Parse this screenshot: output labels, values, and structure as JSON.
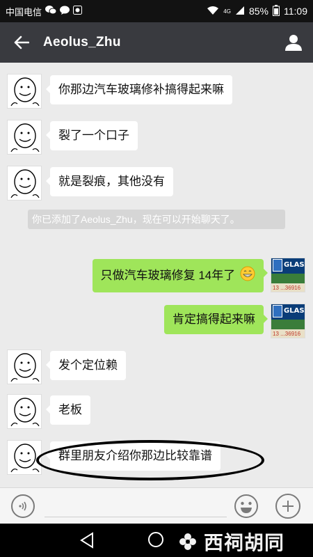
{
  "status_bar": {
    "carrier": "中国电信",
    "signal_label": "4G",
    "battery": "85%",
    "time": "11:09"
  },
  "header": {
    "title": "Aeolus_Zhu"
  },
  "messages": [
    {
      "side": "in",
      "text": "你那边汽车玻璃修补搞得起来嘛"
    },
    {
      "side": "in",
      "text": "裂了一个口子"
    },
    {
      "side": "in",
      "text": "就是裂痕，其他没有"
    },
    {
      "side": "system",
      "text": "你已添加了Aeolus_Zhu，现在可以开始聊天了。"
    },
    {
      "side": "out",
      "text": "只做汽车玻璃修复 14年了"
    },
    {
      "side": "out",
      "text": "肯定搞得起来嘛"
    },
    {
      "side": "in",
      "text": "发个定位赖"
    },
    {
      "side": "in",
      "text": "老板"
    },
    {
      "side": "in",
      "text": "群里朋友介绍你那边比较靠谱"
    }
  ],
  "sender_avatar": {
    "logo_text": "GLASS",
    "phone": "13 ...36916"
  },
  "watermark": "西祠胡同",
  "colors": {
    "title_bar": "#393a3f",
    "outgoing_bubble": "#9fe55a",
    "incoming_bubble": "#ffffff",
    "chat_background": "#ebebeb"
  }
}
